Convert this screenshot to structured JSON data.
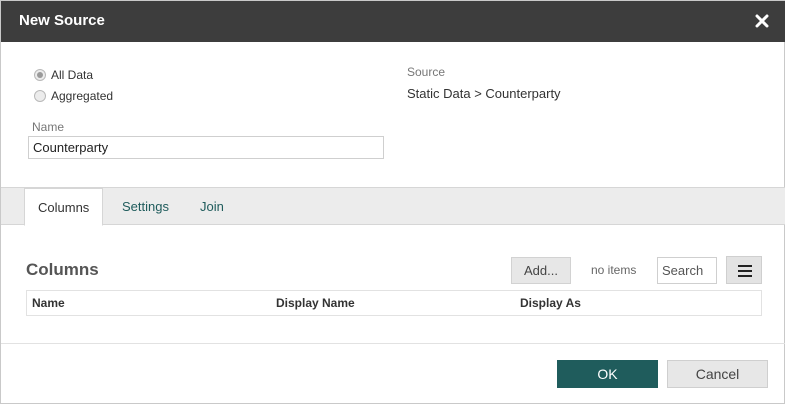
{
  "dialog": {
    "title": "New Source"
  },
  "options": {
    "all_data_label": "All Data",
    "aggregated_label": "Aggregated",
    "selected": "All Data"
  },
  "source": {
    "label": "Source",
    "value": "Static Data > Counterparty"
  },
  "name_field": {
    "label": "Name",
    "value": "Counterparty"
  },
  "tabs": [
    {
      "label": "Columns",
      "active": true
    },
    {
      "label": "Settings",
      "active": false
    },
    {
      "label": "Join",
      "active": false
    }
  ],
  "columns_section": {
    "title": "Columns",
    "add_label": "Add...",
    "count_text": "no items",
    "search_placeholder": "Search",
    "menu_icon": "hamburger-menu-icon",
    "headers": [
      "Name",
      "Display Name",
      "Display As"
    ],
    "rows": []
  },
  "footer": {
    "ok_label": "OK",
    "cancel_label": "Cancel"
  },
  "colors": {
    "titlebar": "#3d3d3d",
    "primary": "#1f5c5c",
    "tabbar": "#ececec"
  }
}
